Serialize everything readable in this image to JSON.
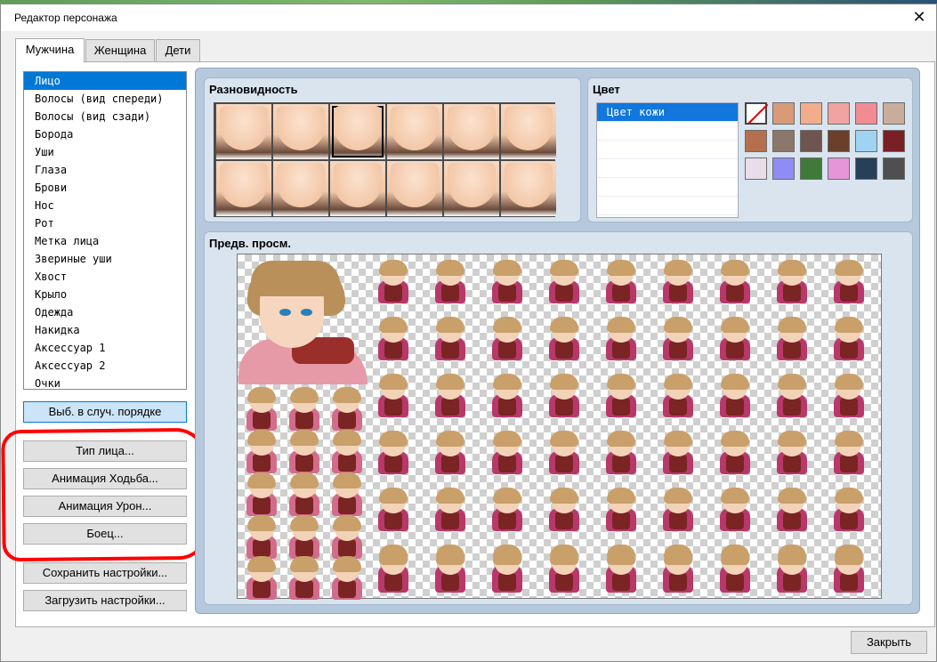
{
  "window": {
    "title": "Редактор персонажа",
    "close_glyph": "✕"
  },
  "tabs": [
    {
      "label": "Мужчина",
      "active": true
    },
    {
      "label": "Женщина",
      "active": false
    },
    {
      "label": "Дети",
      "active": false
    }
  ],
  "parts_list": {
    "selected_index": 0,
    "items": [
      "Лицо",
      "Волосы (вид спереди)",
      "Волосы (вид сзади)",
      "Борода",
      "Уши",
      "Глаза",
      "Брови",
      "Нос",
      "Рот",
      "Метка лица",
      "Звериные уши",
      "Хвост",
      "Крыло",
      "Одежда",
      "Накидка",
      "Аксессуар 1",
      "Аксессуар 2",
      "Очки"
    ]
  },
  "buttons": {
    "random": "Выб. в случ. порядке",
    "face_type": "Тип лица...",
    "walk_anim": "Анимация Ходьба...",
    "damage_anim": "Анимация Урон...",
    "fighter": "Боец...",
    "save_settings": "Сохранить настройки...",
    "load_settings": "Загрузить настройки...",
    "close": "Закрыть"
  },
  "variety": {
    "title": "Разновидность",
    "selected_index": 2,
    "count": 12
  },
  "color": {
    "title": "Цвет",
    "list_items": [
      "Цвет кожи",
      "",
      "",
      "",
      "",
      ""
    ],
    "selected_index": 0,
    "swatches": [
      "none",
      "#d99a78",
      "#f2ad8d",
      "#f0a3a0",
      "#f18c93",
      "#c8ad9c",
      "#b66f4d",
      "#8b786b",
      "#6e5550",
      "#6b3f2a",
      "#9ed4f2",
      "#7a1f24",
      "#e8dde8",
      "#8f8cf5",
      "#3f7a39",
      "#e496d8",
      "#283f58",
      "#4f4f4f"
    ]
  },
  "preview": {
    "title": "Предв. просм."
  },
  "annotation": {
    "color": "#ff0000"
  }
}
